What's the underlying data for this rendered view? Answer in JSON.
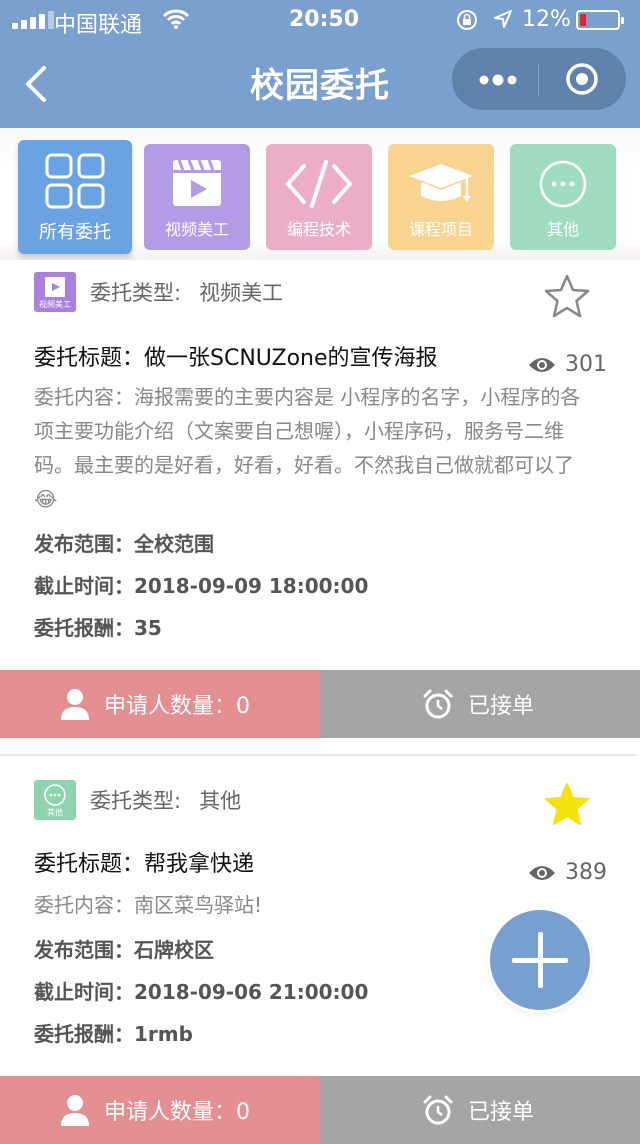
{
  "status_bar": {
    "carrier": "中国联通",
    "time": "20:50",
    "battery": "12%",
    "battery_level": 0.12
  },
  "nav": {
    "title": "校园委托"
  },
  "categories": [
    {
      "label": "所有委托",
      "color": "#6ba3e2",
      "icon": "grid-icon",
      "active": true
    },
    {
      "label": "视频美工",
      "color": "#b39be6",
      "icon": "video-icon",
      "active": false
    },
    {
      "label": "编程技术",
      "color": "#ecadc6",
      "icon": "code-icon",
      "active": false
    },
    {
      "label": "课程项目",
      "color": "#f8d490",
      "icon": "graduation-cap-icon",
      "active": false
    },
    {
      "label": "其他",
      "color": "#9fdcbf",
      "icon": "more-icon",
      "active": false
    }
  ],
  "tasks": [
    {
      "type_icon_label": "视频美工",
      "type_icon_color": "#a980e0",
      "type_label": "委托类型:",
      "type_value": "视频美工",
      "starred": false,
      "title": "委托标题：做一张SCNUZone的宣传海报",
      "views": "301",
      "content": "委托内容：海报需要的主要内容是 小程序的名字，小程序的各项主要功能介绍（文案要自己想喔），小程序码，服务号二维码。最主要的是好看，好看，好看。不然我自己做就都可以了😂",
      "scope": "发布范围：全校范围",
      "deadline": "截止时间：2018-09-09 18:00:00",
      "reward": "委托报酬：35",
      "applicants": "申请人数量：0",
      "status": "已接单"
    },
    {
      "type_icon_label": "其他",
      "type_icon_color": "#8fd4ae",
      "type_label": "委托类型:",
      "type_value": "其他",
      "starred": true,
      "title": "委托标题：帮我拿快递",
      "views": "389",
      "content": "委托内容：南区菜鸟驿站!",
      "scope": "发布范围：石牌校区",
      "deadline": "截止时间：2018-09-06 21:00:00",
      "reward": "委托报酬：1rmb",
      "applicants": "申请人数量：0",
      "status": "已接单"
    }
  ],
  "colors": {
    "nav_bg": "#7aa0cf",
    "applicants_bg": "#e48f91",
    "status_bg": "#a5a5a5",
    "fab": "#779fd0",
    "star_filled": "#f5e10e"
  }
}
